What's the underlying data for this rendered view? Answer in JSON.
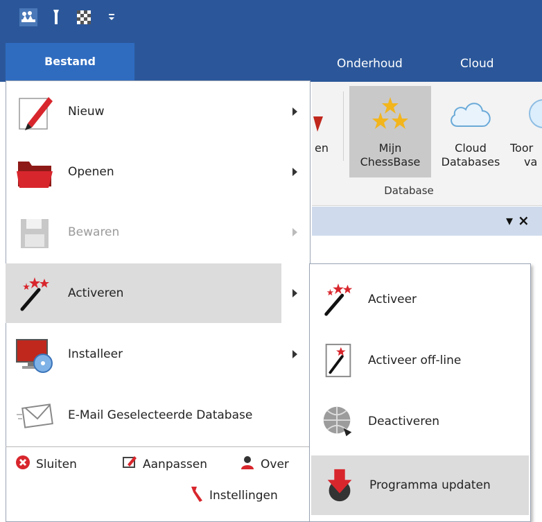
{
  "quick_access": {
    "icons": [
      "chess-pieces-icon",
      "wrench-icon",
      "board-icon",
      "customize-quick-access-icon"
    ]
  },
  "tabs": {
    "file": "Bestand",
    "items": [
      {
        "label": "Onderhoud"
      },
      {
        "label": "Cloud"
      }
    ]
  },
  "ribbon": {
    "partial_label": "en",
    "buttons": [
      {
        "line1": "Mijn",
        "line2": "ChessBase",
        "selected": true
      },
      {
        "line1": "Cloud",
        "line2": "Databases",
        "selected": false
      },
      {
        "line1": "Toor",
        "line2": "va",
        "selected": false
      }
    ],
    "group_label": "Database"
  },
  "panel": {
    "controls": "▾ ×"
  },
  "file_menu": {
    "items": [
      {
        "label": "Nieuw",
        "submenu": true,
        "enabled": true
      },
      {
        "label": "Openen",
        "submenu": true,
        "enabled": true
      },
      {
        "label": "Bewaren",
        "submenu": true,
        "enabled": false
      },
      {
        "label": "Activeren",
        "submenu": true,
        "enabled": true,
        "highlighted": true
      },
      {
        "label": "Installeer",
        "submenu": true,
        "enabled": true
      },
      {
        "label": "E-Mail Geselecteerde Database",
        "submenu": false,
        "enabled": true
      }
    ],
    "footer": {
      "close": "Sluiten",
      "customize": "Aanpassen",
      "about": "Over",
      "settings": "Instellingen"
    }
  },
  "activate_submenu": {
    "items": [
      {
        "label": "Activeer"
      },
      {
        "label": "Activeer off-line"
      },
      {
        "label": "Deactiveren"
      },
      {
        "label": "Programma updaten",
        "highlighted": true
      }
    ]
  },
  "colors": {
    "titlebar": "#2b579a",
    "file_tab": "#2f6cc0",
    "highlight": "#dcdcdc",
    "panel_strip": "#cfdbec"
  }
}
